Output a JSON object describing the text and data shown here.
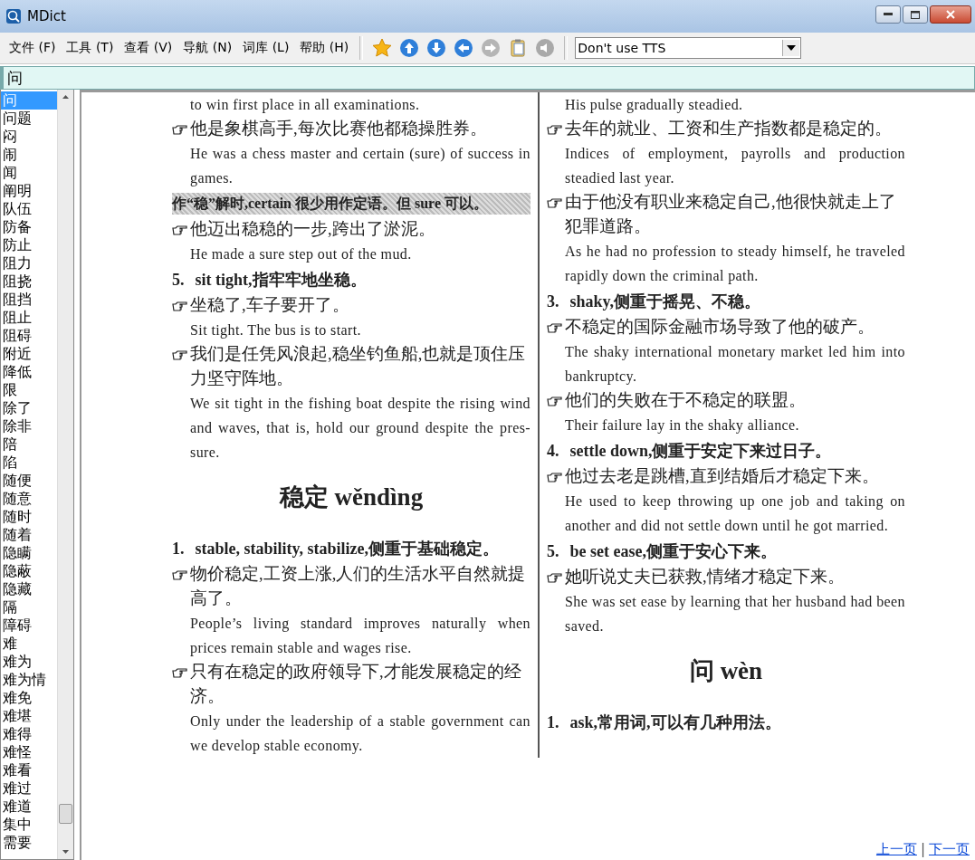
{
  "window": {
    "title": "MDict"
  },
  "menu": [
    "文件 (F)",
    "工具 (T)",
    "查看 (V)",
    "导航 (N)",
    "词库 (L)",
    "帮助 (H)"
  ],
  "toolbar": [
    {
      "kind": "star",
      "disabled": false
    },
    {
      "kind": "up",
      "disabled": false
    },
    {
      "kind": "down",
      "disabled": false
    },
    {
      "kind": "back",
      "disabled": false
    },
    {
      "kind": "forward",
      "disabled": true
    },
    {
      "kind": "clipboard",
      "disabled": false
    },
    {
      "kind": "speaker",
      "disabled": true
    }
  ],
  "tts": {
    "value": "Don't use TTS"
  },
  "search": {
    "value": "问"
  },
  "word_list": [
    {
      "label": "问",
      "selected": true
    },
    {
      "label": "问题",
      "selected": false
    },
    {
      "label": "闷",
      "selected": false
    },
    {
      "label": "闹",
      "selected": false
    },
    {
      "label": "闻",
      "selected": false
    },
    {
      "label": "阐明",
      "selected": false
    },
    {
      "label": "队伍",
      "selected": false
    },
    {
      "label": "防备",
      "selected": false
    },
    {
      "label": "防止",
      "selected": false
    },
    {
      "label": "阻力",
      "selected": false
    },
    {
      "label": "阻挠",
      "selected": false
    },
    {
      "label": "阻挡",
      "selected": false
    },
    {
      "label": "阻止",
      "selected": false
    },
    {
      "label": "阻碍",
      "selected": false
    },
    {
      "label": "附近",
      "selected": false
    },
    {
      "label": "降低",
      "selected": false
    },
    {
      "label": "限",
      "selected": false
    },
    {
      "label": "除了",
      "selected": false
    },
    {
      "label": "除非",
      "selected": false
    },
    {
      "label": "陪",
      "selected": false
    },
    {
      "label": "陷",
      "selected": false
    },
    {
      "label": "随便",
      "selected": false
    },
    {
      "label": "随意",
      "selected": false
    },
    {
      "label": "随时",
      "selected": false
    },
    {
      "label": "随着",
      "selected": false
    },
    {
      "label": "隐瞒",
      "selected": false
    },
    {
      "label": "隐蔽",
      "selected": false
    },
    {
      "label": "隐藏",
      "selected": false
    },
    {
      "label": "隔",
      "selected": false
    },
    {
      "label": "障碍",
      "selected": false
    },
    {
      "label": "难",
      "selected": false
    },
    {
      "label": "难为",
      "selected": false
    },
    {
      "label": "难为情",
      "selected": false
    },
    {
      "label": "难免",
      "selected": false
    },
    {
      "label": "难堪",
      "selected": false
    },
    {
      "label": "难得",
      "selected": false
    },
    {
      "label": "难怪",
      "selected": false
    },
    {
      "label": "难看",
      "selected": false
    },
    {
      "label": "难过",
      "selected": false
    },
    {
      "label": "难道",
      "selected": false
    },
    {
      "label": "集中",
      "selected": false
    },
    {
      "label": "需要",
      "selected": false
    }
  ],
  "page": {
    "columns": [
      [
        {
          "kind": "english",
          "text": "to win first place in all examinations."
        },
        {
          "kind": "example",
          "text": "他是象棋高手,每次比赛他都稳操胜券。"
        },
        {
          "kind": "english",
          "text": "He was a chess master and certain (sure) of success in games."
        },
        {
          "kind": "note",
          "text": "作“稳”解时,certain 很少用作定语。但 sure 可以。"
        },
        {
          "kind": "example",
          "text": "他迈出稳稳的一步,跨出了淤泥。"
        },
        {
          "kind": "english",
          "text": "He made a sure step out of the mud."
        },
        {
          "kind": "sense",
          "number": "5.",
          "text": "sit tight,指牢牢地坐稳。"
        },
        {
          "kind": "example",
          "text": "坐稳了,车子要开了。"
        },
        {
          "kind": "english",
          "text": "Sit tight. The bus is to start."
        },
        {
          "kind": "example",
          "text": "我们是任凭风浪起,稳坐钓鱼船,也就是顶住压力坚守阵地。"
        },
        {
          "kind": "english",
          "text": "We sit tight in the fishing boat despite the rising wind and waves, that is, hold our ground despite the pres-sure."
        },
        {
          "kind": "headword",
          "text": "稳定 wěndìng"
        },
        {
          "kind": "sense",
          "number": "1.",
          "text": "stable, stability, stabilize,侧重于基础稳定。"
        },
        {
          "kind": "example",
          "text": "物价稳定,工资上涨,人们的生活水平自然就提高了。"
        },
        {
          "kind": "english",
          "text": "People’s living standard improves naturally when prices remain stable and wages rise."
        },
        {
          "kind": "example",
          "text": "只有在稳定的政府领导下,才能发展稳定的经济。"
        },
        {
          "kind": "english",
          "text": "Only under the leadership of a stable government can we develop stable economy."
        }
      ],
      [
        {
          "kind": "english",
          "text": "His pulse gradually steadied."
        },
        {
          "kind": "example",
          "text": "去年的就业、工资和生产指数都是稳定的。"
        },
        {
          "kind": "english",
          "text": "Indices of employment, payrolls and production steadied last year."
        },
        {
          "kind": "example",
          "text": "由于他没有职业来稳定自己,他很快就走上了犯罪道路。"
        },
        {
          "kind": "english",
          "text": "As he had no profession to steady himself, he traveled rapidly down the criminal path."
        },
        {
          "kind": "sense",
          "number": "3.",
          "text": "shaky,侧重于摇晃、不稳。"
        },
        {
          "kind": "example",
          "text": "不稳定的国际金融市场导致了他的破产。"
        },
        {
          "kind": "english",
          "text": "The shaky international monetary market led him into bankruptcy."
        },
        {
          "kind": "example",
          "text": "他们的失败在于不稳定的联盟。"
        },
        {
          "kind": "english",
          "text": "Their failure lay in the shaky alliance."
        },
        {
          "kind": "sense",
          "number": "4.",
          "text": "settle down,侧重于安定下来过日子。"
        },
        {
          "kind": "example",
          "text": "他过去老是跳槽,直到结婚后才稳定下来。"
        },
        {
          "kind": "english",
          "text": "He used to keep throwing up one job and taking on another and did not settle down until he got married."
        },
        {
          "kind": "sense",
          "number": "5.",
          "text": "be set ease,侧重于安心下来。"
        },
        {
          "kind": "example",
          "text": "她听说丈夫已获救,情绪才稳定下来。"
        },
        {
          "kind": "english",
          "text": "She was set ease by learning that her husband had been saved."
        },
        {
          "kind": "headword",
          "text": "问 wèn"
        },
        {
          "kind": "sense",
          "number": "1.",
          "text": "ask,常用词,可以有几种用法。"
        }
      ]
    ]
  },
  "pager": {
    "previous": "上一页",
    "separator": "|",
    "next": "下一页"
  }
}
